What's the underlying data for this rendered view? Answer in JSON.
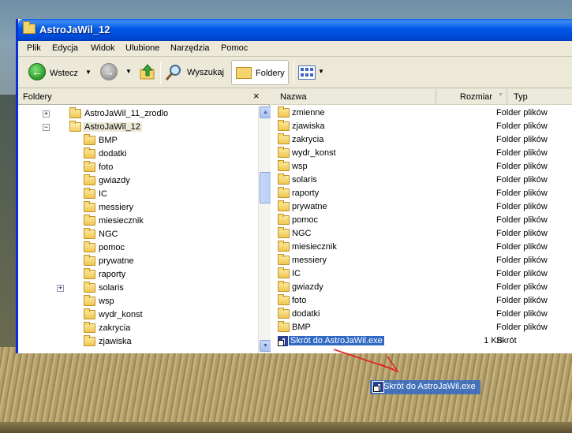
{
  "window": {
    "title": "AstroJaWil_12"
  },
  "menu": [
    "Plik",
    "Edycja",
    "Widok",
    "Ulubione",
    "Narzędzia",
    "Pomoc"
  ],
  "toolbar": {
    "back_label": "Wstecz",
    "search_label": "Wyszukaj",
    "folders_label": "Foldery"
  },
  "left_pane": {
    "title": "Foldery",
    "close": "×",
    "tree": [
      {
        "label": "AstroJaWil_11_zrodlo",
        "level": 0,
        "expander": "+",
        "selected": false
      },
      {
        "label": "AstroJaWil_12",
        "level": 0,
        "expander": "−",
        "selected": true,
        "open": true
      },
      {
        "label": "BMP",
        "level": 1
      },
      {
        "label": "dodatki",
        "level": 1
      },
      {
        "label": "foto",
        "level": 1
      },
      {
        "label": "gwiazdy",
        "level": 1
      },
      {
        "label": "IC",
        "level": 1
      },
      {
        "label": "messiery",
        "level": 1
      },
      {
        "label": "miesiecznik",
        "level": 1
      },
      {
        "label": "NGC",
        "level": 1
      },
      {
        "label": "pomoc",
        "level": 1
      },
      {
        "label": "prywatne",
        "level": 1
      },
      {
        "label": "raporty",
        "level": 1
      },
      {
        "label": "solaris",
        "level": 1,
        "expander": "+"
      },
      {
        "label": "wsp",
        "level": 1
      },
      {
        "label": "wydr_konst",
        "level": 1
      },
      {
        "label": "zakrycia",
        "level": 1
      },
      {
        "label": "zjawiska",
        "level": 1
      }
    ]
  },
  "columns": {
    "name": "Nazwa",
    "size": "Rozmiar",
    "type": "Typ"
  },
  "files": [
    {
      "name": "zmienne",
      "type": "Folder plików"
    },
    {
      "name": "zjawiska",
      "type": "Folder plików"
    },
    {
      "name": "zakrycia",
      "type": "Folder plików"
    },
    {
      "name": "wydr_konst",
      "type": "Folder plików"
    },
    {
      "name": "wsp",
      "type": "Folder plików"
    },
    {
      "name": "solaris",
      "type": "Folder plików"
    },
    {
      "name": "raporty",
      "type": "Folder plików"
    },
    {
      "name": "prywatne",
      "type": "Folder plików"
    },
    {
      "name": "pomoc",
      "type": "Folder plików"
    },
    {
      "name": "NGC",
      "type": "Folder plików"
    },
    {
      "name": "miesiecznik",
      "type": "Folder plików"
    },
    {
      "name": "messiery",
      "type": "Folder plików"
    },
    {
      "name": "IC",
      "type": "Folder plików"
    },
    {
      "name": "gwiazdy",
      "type": "Folder plików"
    },
    {
      "name": "foto",
      "type": "Folder plików"
    },
    {
      "name": "dodatki",
      "type": "Folder plików"
    },
    {
      "name": "BMP",
      "type": "Folder plików"
    },
    {
      "name": "Skrót do AstroJaWil.exe",
      "size": "1 KB",
      "type": "Skrót",
      "selected": true,
      "shortcut": true
    }
  ],
  "drag": {
    "label": "Skrót do AstroJaWil.exe"
  },
  "colors": {
    "titlebar": "#0058e6",
    "selection": "#316ac5",
    "arrow": "#e21d1d"
  },
  "icons": {
    "back": "arrow-left-icon",
    "forward": "arrow-right-icon",
    "up": "folder-up-icon",
    "search": "magnifier-icon",
    "folders": "folder-icon",
    "views": "views-icon"
  }
}
